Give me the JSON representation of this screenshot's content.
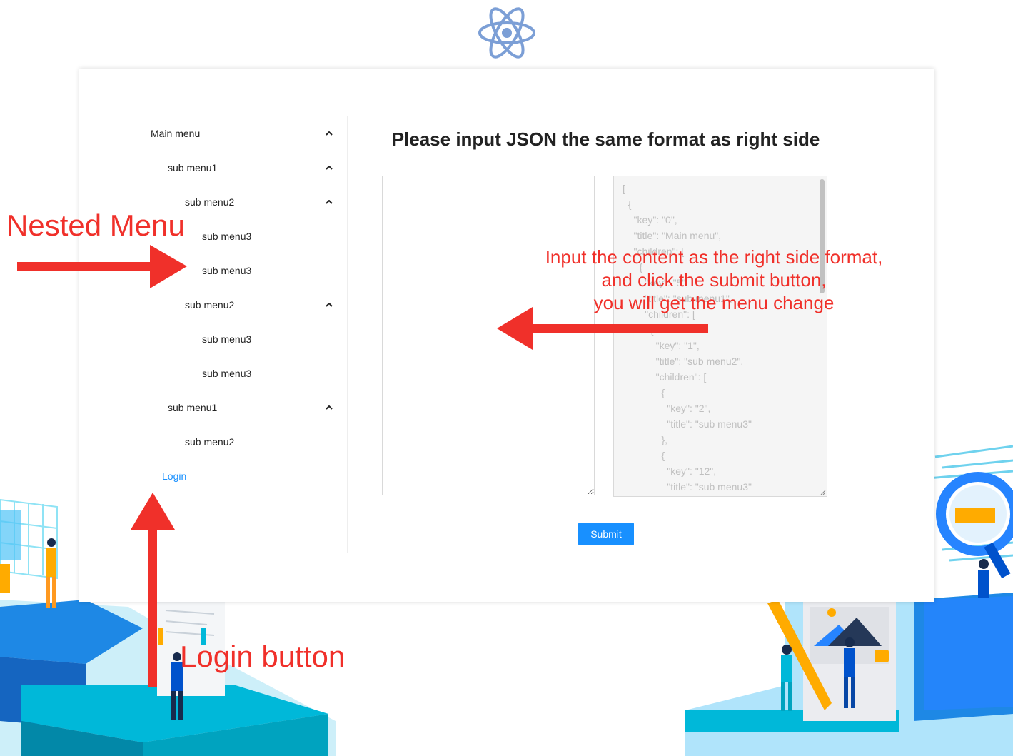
{
  "menu": {
    "items": [
      {
        "label": "Main menu",
        "level": 0,
        "expanded": true
      },
      {
        "label": "sub menu1",
        "level": 1,
        "expanded": true
      },
      {
        "label": "sub menu2",
        "level": 2,
        "expanded": true
      },
      {
        "label": "sub menu3",
        "level": 3
      },
      {
        "label": "sub menu3",
        "level": 3
      },
      {
        "label": "sub menu2",
        "level": 2,
        "expanded": true
      },
      {
        "label": "sub menu3",
        "level": 3
      },
      {
        "label": "sub menu3",
        "level": 3
      },
      {
        "label": "sub menu1",
        "level": 1,
        "expanded": true
      },
      {
        "label": "sub menu2",
        "level": 2
      }
    ],
    "login_label": "Login"
  },
  "main": {
    "title": "Please input JSON the same format as right side",
    "input_value": "",
    "example_json": "[\n  {\n    \"key\": \"0\",\n    \"title\": \"Main menu\",\n    \"children\": [\n      {\n        \"key\": \"5\",\n        \"title\": \"sub menu1\",\n        \"children\": [\n          {\n            \"key\": \"1\",\n            \"title\": \"sub menu2\",\n            \"children\": [\n              {\n                \"key\": \"2\",\n                \"title\": \"sub menu3\"\n              },\n              {\n                \"key\": \"12\",\n                \"title\": \"sub menu3\"",
    "submit_label": "Submit"
  },
  "annotations": {
    "nested_menu": "Nested Menu",
    "input_hint_line1": "Input the content as the right side format,",
    "input_hint_line2": "and click the submit button,",
    "input_hint_line3": "you will get the menu change",
    "login_button": "Login button"
  },
  "icons": {
    "logo": "react-atom-icon",
    "chevron": "chevron-up-icon"
  },
  "colors": {
    "primary": "#1890ff",
    "annotation": "#f0302a",
    "logo": "#7c9fd6"
  }
}
